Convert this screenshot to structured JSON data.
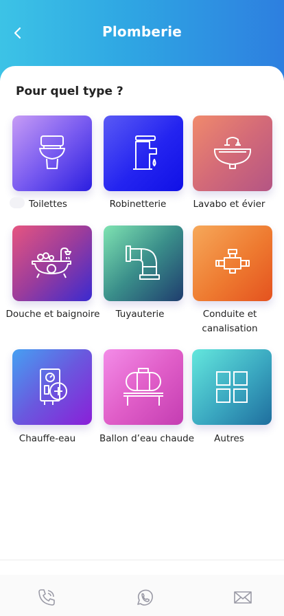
{
  "header": {
    "title": "Plomberie"
  },
  "question": "Pour quel type ?",
  "categories": [
    {
      "label": "Toilettes",
      "icon": "toilet-icon"
    },
    {
      "label": "Robinetterie",
      "icon": "faucet-icon"
    },
    {
      "label": "Lavabo et évier",
      "icon": "sink-icon"
    },
    {
      "label": "Douche et baignoire",
      "icon": "bathtub-icon"
    },
    {
      "label": "Tuyauterie",
      "icon": "pipe-elbow-icon"
    },
    {
      "label": "Conduite et canalisation",
      "icon": "pipe-fitting-icon"
    },
    {
      "label": "Chauffe-eau",
      "icon": "water-heater-icon"
    },
    {
      "label": "Ballon d’eau chaude",
      "icon": "water-tank-icon"
    },
    {
      "label": "Autres",
      "icon": "grid-icon"
    }
  ],
  "bottom_nav": [
    {
      "icon": "phone-icon"
    },
    {
      "icon": "whatsapp-icon"
    },
    {
      "icon": "mail-icon"
    }
  ]
}
